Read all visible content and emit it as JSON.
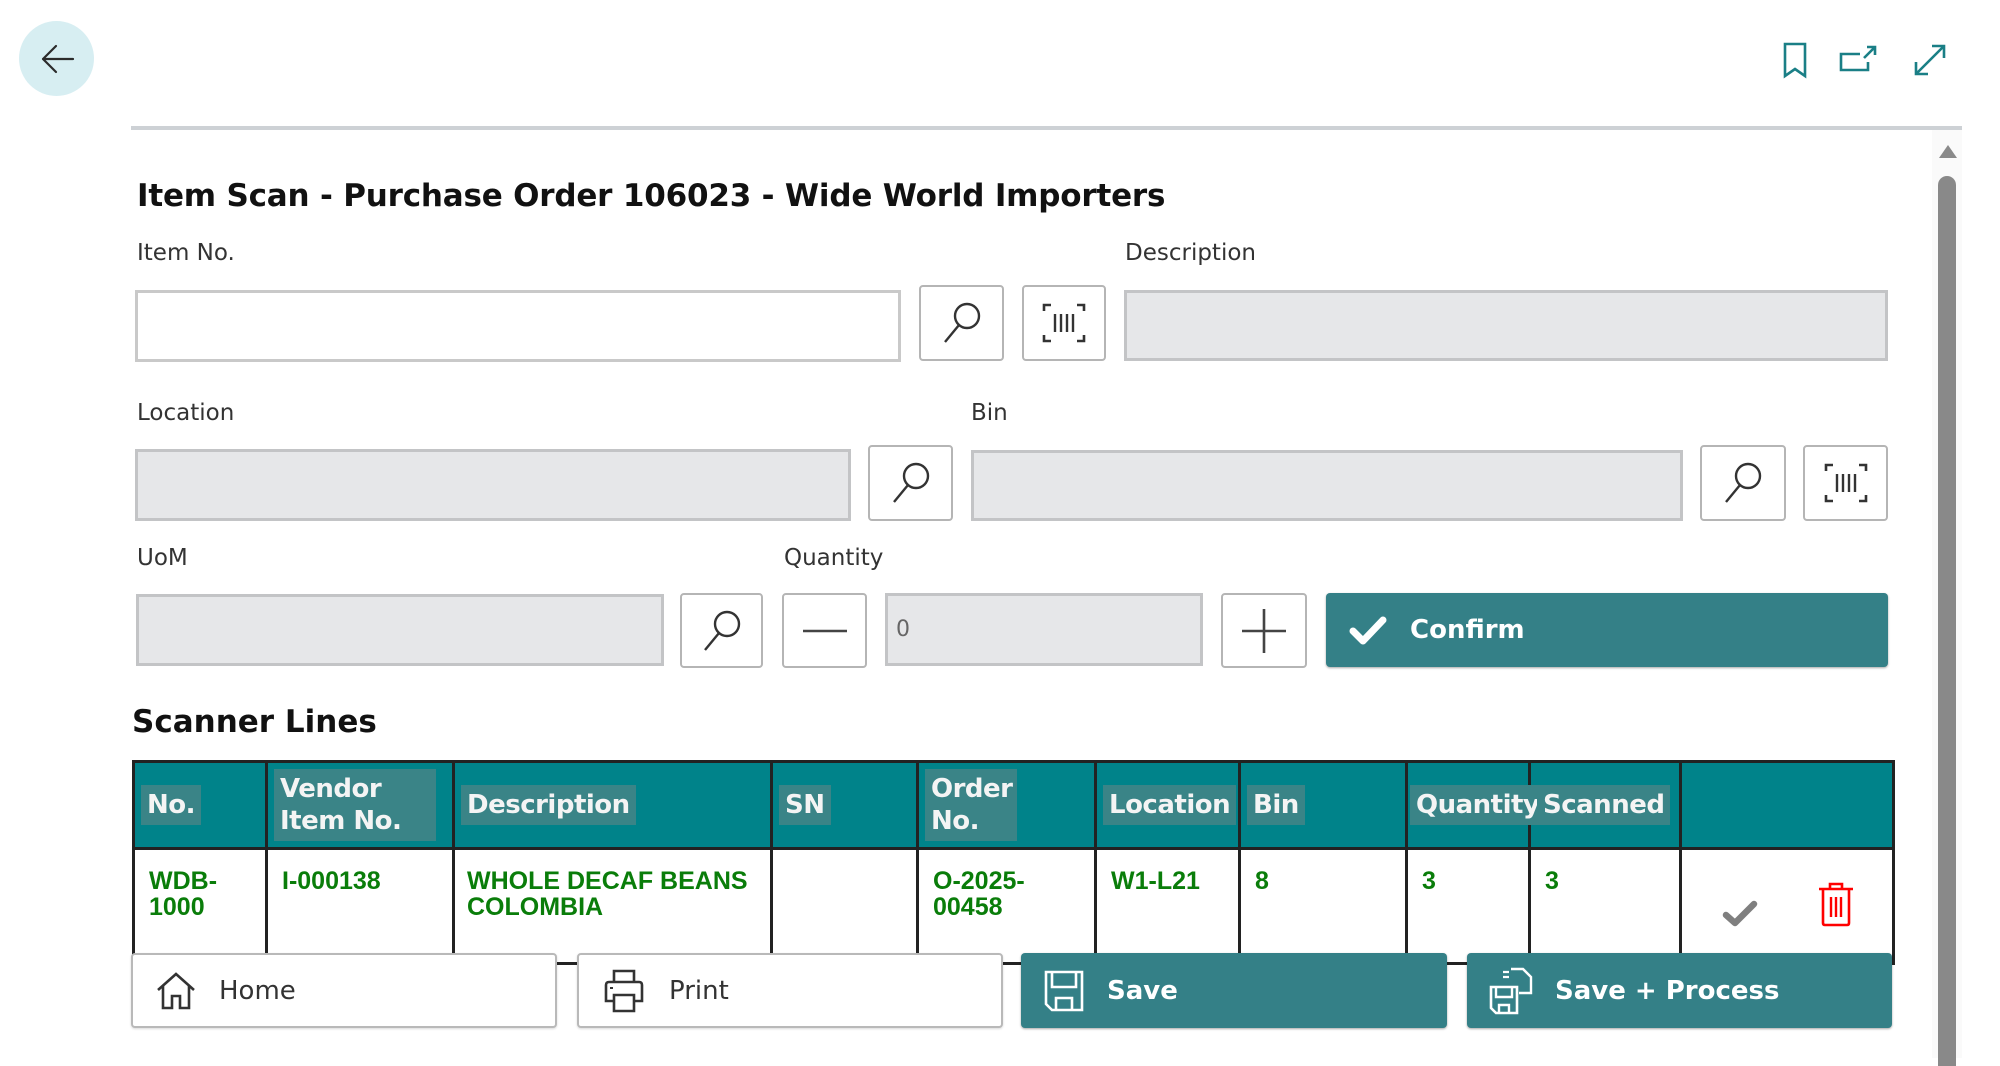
{
  "header": {
    "back_icon": "arrow-left-icon",
    "actions": [
      {
        "name": "bookmark",
        "icon": "bookmark-icon"
      },
      {
        "name": "open-in-new-window",
        "icon": "open-external-icon"
      },
      {
        "name": "expand",
        "icon": "expand-diagonal-icon"
      }
    ]
  },
  "page": {
    "title": "Item Scan - Purchase Order 106023 - Wide World Importers"
  },
  "form": {
    "item_no": {
      "label": "Item No.",
      "value": "",
      "placeholder": ""
    },
    "description": {
      "label": "Description",
      "value": ""
    },
    "location": {
      "label": "Location",
      "value": ""
    },
    "bin": {
      "label": "Bin",
      "value": ""
    },
    "uom": {
      "label": "UoM",
      "value": ""
    },
    "quantity": {
      "label": "Quantity",
      "value": "0"
    },
    "confirm_label": "Confirm"
  },
  "scanner_lines": {
    "title": "Scanner Lines",
    "columns": [
      "No.",
      "Vendor Item No.",
      "Description",
      "SN",
      "Order No.",
      "Location",
      "Bin",
      "Quantity",
      "Scanned",
      ""
    ],
    "rows": [
      {
        "no": "WDB-1000",
        "vendor_item_no": "I-000138",
        "description": "WHOLE DECAF BEANS COLOMBIA",
        "sn": "",
        "order_no": "O-2025-00458",
        "location": "W1-L21",
        "bin": "8",
        "quantity": "3",
        "scanned": "3"
      }
    ]
  },
  "footer": {
    "home_label": "Home",
    "print_label": "Print",
    "save_label": "Save",
    "save_process_label": "Save + Process"
  },
  "colors": {
    "primary": "#348087",
    "header_bg": "#00838a",
    "row_text": "#0a7d0a",
    "delete": "#ff0000",
    "back_button_bg": "#d7eef2"
  }
}
